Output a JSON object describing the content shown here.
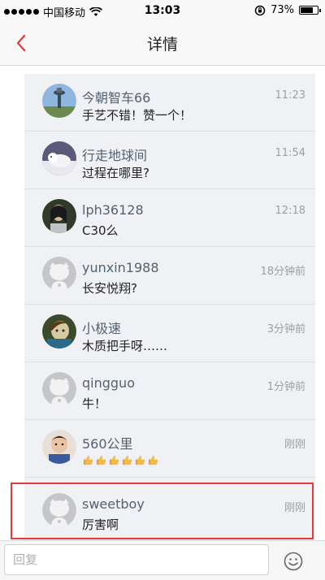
{
  "status_bar": {
    "carrier": "中国移动",
    "time": "13:03",
    "battery_percent": "73%",
    "battery_level": 0.73
  },
  "nav": {
    "title": "详情",
    "back_icon": "chevron-left-icon",
    "accent_color": "#e53a3a"
  },
  "comments": [
    {
      "author": "今朝智车66",
      "text": "手艺不错！赞一个！",
      "time": "11:23",
      "avatar": "tower-photo"
    },
    {
      "author": "行走地球间",
      "text": "过程在哪里?",
      "time": "11:54",
      "avatar": "wolf-photo"
    },
    {
      "author": "lph36128",
      "text": "C30么",
      "time": "12:18",
      "avatar": "portrait-photo"
    },
    {
      "author": "yunxin1988",
      "text": "长安悦翔?",
      "time": "18分钟前",
      "avatar": "default-avatar"
    },
    {
      "author": "小极速",
      "text": "木质把手呀……",
      "time": "3分钟前",
      "avatar": "anime-photo"
    },
    {
      "author": "qingguo",
      "text": "牛！",
      "time": "1分钟前",
      "avatar": "default-avatar"
    },
    {
      "author": "560公里",
      "text": "",
      "time": "刚刚",
      "avatar": "child-photo",
      "emoji": [
        "thumbs-up",
        "thumbs-up",
        "thumbs-up",
        "thumbs-up",
        "thumbs-up",
        "thumbs-up"
      ]
    },
    {
      "author": "sweetboy",
      "text": "厉害啊",
      "time": "刚刚",
      "avatar": "default-avatar",
      "highlighted": true
    }
  ],
  "reply_bar": {
    "placeholder": "回复",
    "emoji_icon": "smiley-icon"
  }
}
